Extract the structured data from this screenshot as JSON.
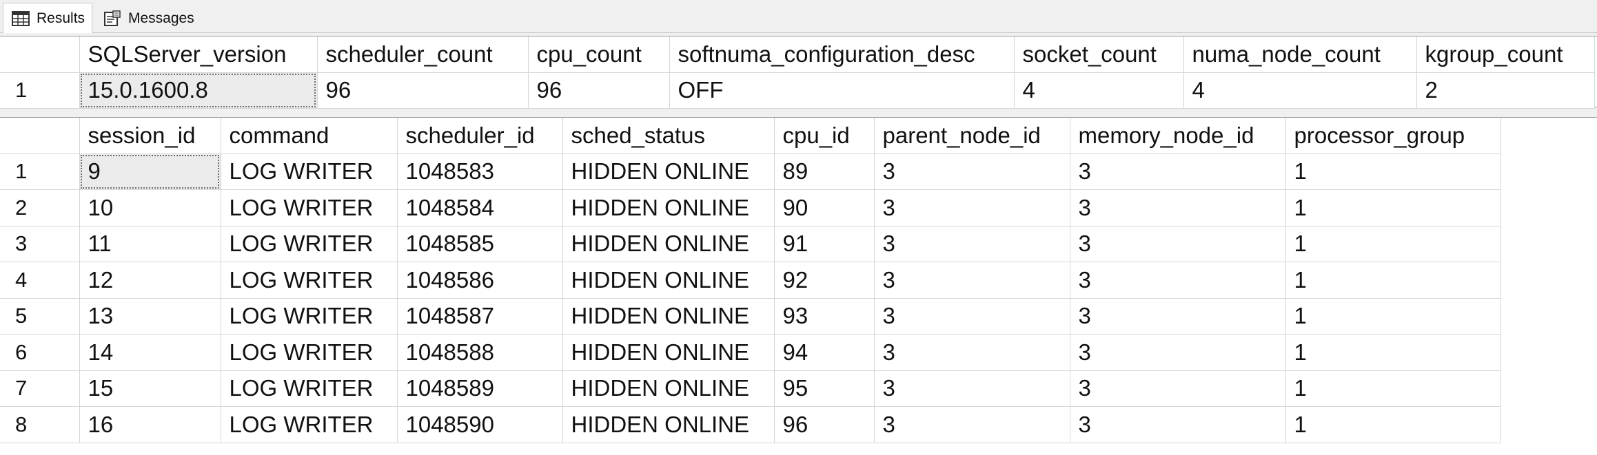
{
  "tabs": [
    {
      "label": "Results",
      "icon": "grid-icon",
      "active": true
    },
    {
      "label": "Messages",
      "icon": "messages-icon",
      "active": false
    }
  ],
  "grid1": {
    "columns": [
      "SQLServer_version",
      "scheduler_count",
      "cpu_count",
      "softnuma_configuration_desc",
      "socket_count",
      "numa_node_count",
      "kgroup_count"
    ],
    "rows": [
      {
        "rn": "1",
        "cells": [
          "15.0.1600.8",
          "96",
          "96",
          "OFF",
          "4",
          "4",
          "2"
        ]
      }
    ]
  },
  "grid2": {
    "columns": [
      "session_id",
      "command",
      "scheduler_id",
      "sched_status",
      "cpu_id",
      "parent_node_id",
      "memory_node_id",
      "processor_group"
    ],
    "rows": [
      {
        "rn": "1",
        "cells": [
          "9",
          "LOG WRITER",
          "1048583",
          "HIDDEN ONLINE",
          "89",
          "3",
          "3",
          "1"
        ]
      },
      {
        "rn": "2",
        "cells": [
          "10",
          "LOG WRITER",
          "1048584",
          "HIDDEN ONLINE",
          "90",
          "3",
          "3",
          "1"
        ]
      },
      {
        "rn": "3",
        "cells": [
          "11",
          "LOG WRITER",
          "1048585",
          "HIDDEN ONLINE",
          "91",
          "3",
          "3",
          "1"
        ]
      },
      {
        "rn": "4",
        "cells": [
          "12",
          "LOG WRITER",
          "1048586",
          "HIDDEN ONLINE",
          "92",
          "3",
          "3",
          "1"
        ]
      },
      {
        "rn": "5",
        "cells": [
          "13",
          "LOG WRITER",
          "1048587",
          "HIDDEN ONLINE",
          "93",
          "3",
          "3",
          "1"
        ]
      },
      {
        "rn": "6",
        "cells": [
          "14",
          "LOG WRITER",
          "1048588",
          "HIDDEN ONLINE",
          "94",
          "3",
          "3",
          "1"
        ]
      },
      {
        "rn": "7",
        "cells": [
          "15",
          "LOG WRITER",
          "1048589",
          "HIDDEN ONLINE",
          "95",
          "3",
          "3",
          "1"
        ]
      },
      {
        "rn": "8",
        "cells": [
          "16",
          "LOG WRITER",
          "1048590",
          "HIDDEN ONLINE",
          "96",
          "3",
          "3",
          "1"
        ]
      }
    ]
  }
}
